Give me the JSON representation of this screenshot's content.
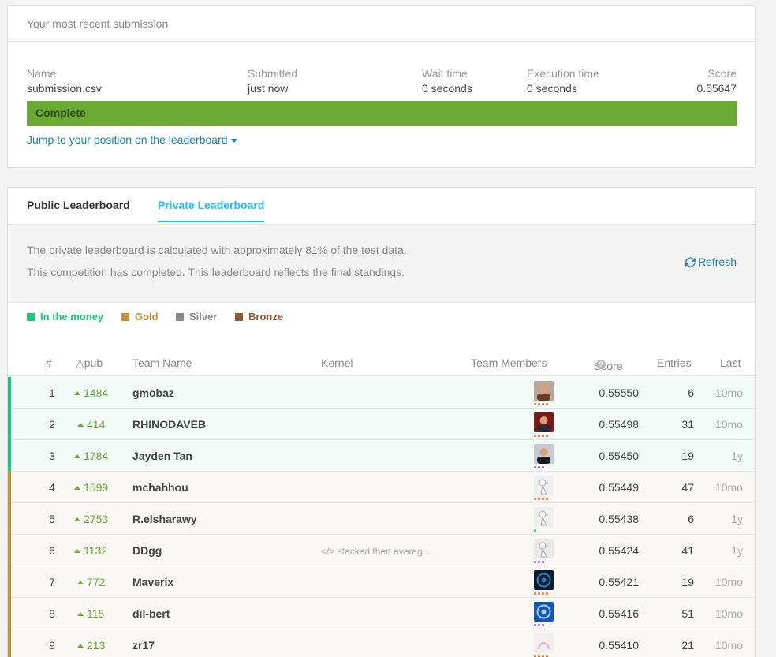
{
  "submission": {
    "header": "Your most recent submission",
    "columns": {
      "name": {
        "label": "Name",
        "value": "submission.csv"
      },
      "submitted": {
        "label": "Submitted",
        "value": "just now"
      },
      "wait": {
        "label": "Wait time",
        "value": "0 seconds"
      },
      "execution": {
        "label": "Execution time",
        "value": "0 seconds"
      },
      "score": {
        "label": "Score",
        "value": "0.55647"
      }
    },
    "status": "Complete",
    "jump_link": "Jump to your position on the leaderboard"
  },
  "leaderboard": {
    "tabs": [
      "Public Leaderboard",
      "Private Leaderboard"
    ],
    "active_tab": "Private Leaderboard",
    "info_line1": "The private leaderboard is calculated with approximately 81% of the test data.",
    "info_line2": "This competition has completed. This leaderboard reflects the final standings.",
    "refresh_label": "Refresh",
    "legend": [
      {
        "label": "In the money",
        "color": "#1fc77a"
      },
      {
        "label": "Gold",
        "color": "#c1913a"
      },
      {
        "label": "Silver",
        "color": "#888888"
      },
      {
        "label": "Bronze",
        "color": "#8e5a35"
      }
    ],
    "headers": {
      "rank": "#",
      "delta": "△pub",
      "team": "Team Name",
      "kernel": "Kernel",
      "members": "Team Members",
      "score": "Score",
      "score_help": "?",
      "entries": "Entries",
      "last": "Last"
    },
    "rows": [
      {
        "rank": "1",
        "delta": "1484",
        "team": "gmobaz",
        "kernel": "",
        "score": "0.55550",
        "entries": "6",
        "last": "10mo"
      },
      {
        "rank": "2",
        "delta": "414",
        "team": "RHINODAVEB",
        "kernel": "",
        "score": "0.55498",
        "entries": "31",
        "last": "10mo"
      },
      {
        "rank": "3",
        "delta": "1784",
        "team": "Jayden Tan",
        "kernel": "",
        "score": "0.55450",
        "entries": "19",
        "last": "1y"
      },
      {
        "rank": "4",
        "delta": "1599",
        "team": "mchahhou",
        "kernel": "",
        "score": "0.55449",
        "entries": "47",
        "last": "10mo"
      },
      {
        "rank": "5",
        "delta": "2753",
        "team": "R.elsharawy",
        "kernel": "",
        "score": "0.55438",
        "entries": "6",
        "last": "1y"
      },
      {
        "rank": "6",
        "delta": "1132",
        "team": "DDgg",
        "kernel": "</> stacked then averag...",
        "score": "0.55424",
        "entries": "41",
        "last": "1y"
      },
      {
        "rank": "7",
        "delta": "772",
        "team": "Maverix",
        "kernel": "",
        "score": "0.55421",
        "entries": "19",
        "last": "10mo"
      },
      {
        "rank": "8",
        "delta": "115",
        "team": "dil-bert",
        "kernel": "",
        "score": "0.55416",
        "entries": "51",
        "last": "10mo"
      },
      {
        "rank": "9",
        "delta": "213",
        "team": "zr17",
        "kernel": "",
        "score": "0.55410",
        "entries": "21",
        "last": "10mo"
      }
    ]
  }
}
